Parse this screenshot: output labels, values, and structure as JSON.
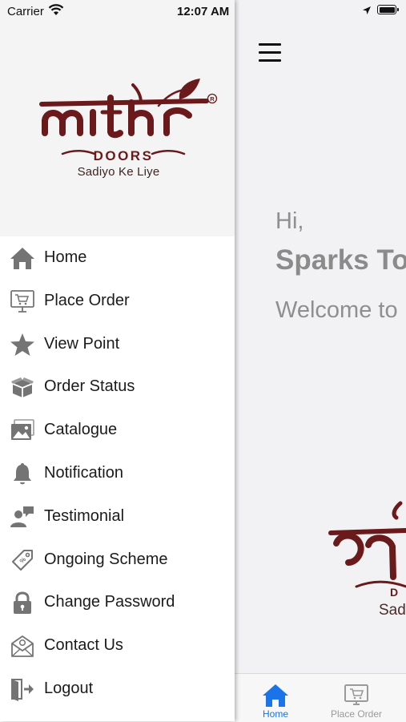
{
  "status_bar": {
    "carrier": "Carrier",
    "time": "12:07 AM"
  },
  "brand": {
    "logo_text": "mithr",
    "logo_sub": "DOORS",
    "tagline": "Sadiyo Ke Liye",
    "color": "#6b1a1c"
  },
  "drawer": {
    "items": [
      {
        "label": "Home",
        "icon": "home-icon"
      },
      {
        "label": "Place Order",
        "icon": "cart-monitor-icon"
      },
      {
        "label": "View Point",
        "icon": "star-icon"
      },
      {
        "label": "Order Status",
        "icon": "box-icon"
      },
      {
        "label": "Catalogue",
        "icon": "gallery-icon"
      },
      {
        "label": "Notification",
        "icon": "bell-icon"
      },
      {
        "label": "Testimonial",
        "icon": "testimonial-icon"
      },
      {
        "label": "Ongoing Scheme",
        "icon": "tag-icon"
      },
      {
        "label": "Change Password",
        "icon": "lock-icon"
      },
      {
        "label": "Contact Us",
        "icon": "contact-icon"
      },
      {
        "label": "Logout",
        "icon": "logout-icon"
      }
    ]
  },
  "main": {
    "greeting": "Hi,",
    "user_name": "Sparks To",
    "welcome": "Welcome to M",
    "tagline_partial": "Sadi"
  },
  "tabbar": {
    "tabs": [
      {
        "label": "Home",
        "icon": "home-icon",
        "active": true
      },
      {
        "label": "Place Order",
        "icon": "cart-monitor-icon",
        "active": false
      }
    ],
    "active_color": "#1a73e8",
    "inactive_color": "#9a9a9a"
  }
}
